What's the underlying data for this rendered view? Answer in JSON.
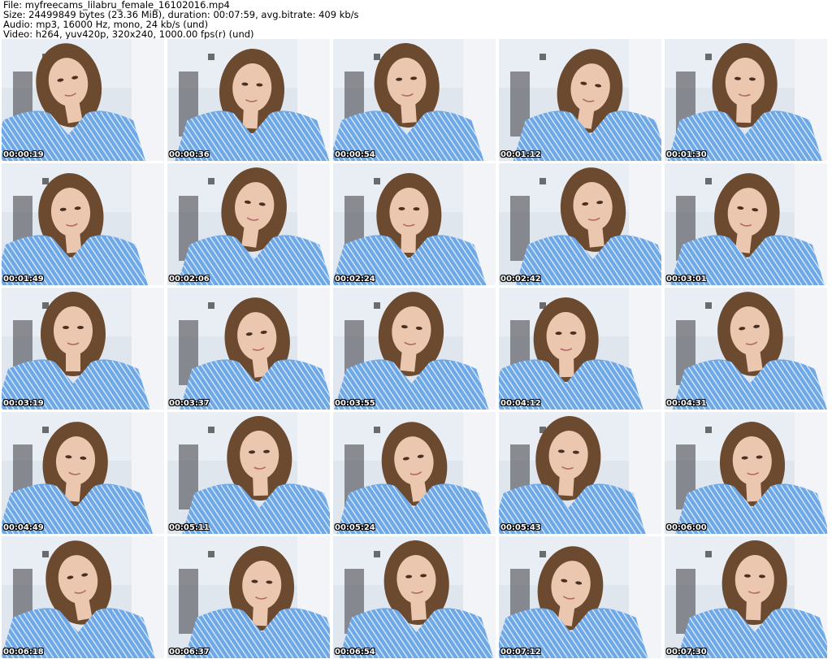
{
  "header": {
    "file_line": "File: myfreecams_lilabru_female_16102016.mp4",
    "size_line": "Size: 24499849 bytes (23.36 MiB), duration: 00:07:59, avg.bitrate: 409 kb/s",
    "audio_line": "Audio: mp3, 16000 Hz, mono, 24 kb/s (und)",
    "video_line": "Video: h264, yuv420p, 320x240, 1000.00 fps(r) (und)"
  },
  "thumbnails": [
    {
      "timestamp": "00:00:19"
    },
    {
      "timestamp": "00:00:36"
    },
    {
      "timestamp": "00:00:54"
    },
    {
      "timestamp": "00:01:12"
    },
    {
      "timestamp": "00:01:30"
    },
    {
      "timestamp": "00:01:49"
    },
    {
      "timestamp": "00:02:06"
    },
    {
      "timestamp": "00:02:24"
    },
    {
      "timestamp": "00:02:42"
    },
    {
      "timestamp": "00:03:01"
    },
    {
      "timestamp": "00:03:19"
    },
    {
      "timestamp": "00:03:37"
    },
    {
      "timestamp": "00:03:55"
    },
    {
      "timestamp": "00:04:12"
    },
    {
      "timestamp": "00:04:31"
    },
    {
      "timestamp": "00:04:49"
    },
    {
      "timestamp": "00:05:11"
    },
    {
      "timestamp": "00:05:24"
    },
    {
      "timestamp": "00:05:43"
    },
    {
      "timestamp": "00:06:00"
    },
    {
      "timestamp": "00:06:18"
    },
    {
      "timestamp": "00:06:37"
    },
    {
      "timestamp": "00:06:54"
    },
    {
      "timestamp": "00:07:12"
    },
    {
      "timestamp": "00:07:30"
    }
  ],
  "colors": {
    "background": "#ffffff",
    "room_wall": "#dfe6ee",
    "shirt": "#6fa8e6",
    "shirt_stripe": "#d6e8fb",
    "hair": "#6b4a2f",
    "skin": "#ecc7b0"
  }
}
